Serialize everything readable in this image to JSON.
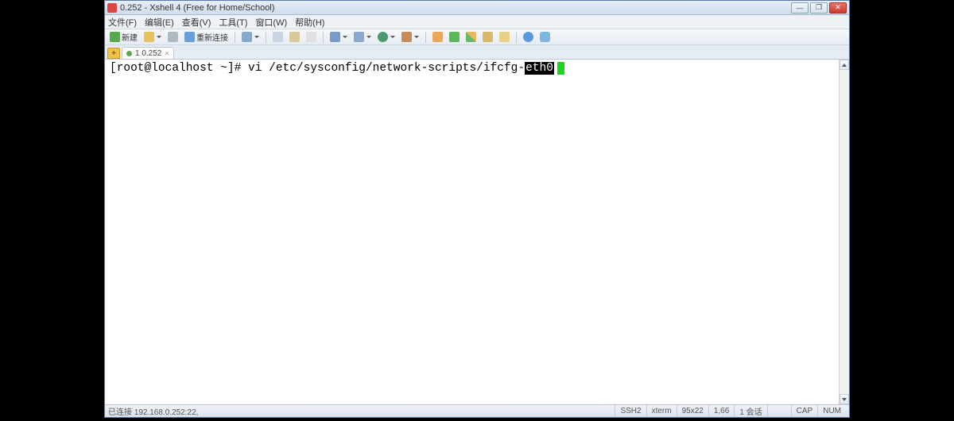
{
  "titlebar": {
    "text": "0.252 - Xshell 4 (Free for Home/School)"
  },
  "menu": {
    "file": "文件(F)",
    "edit": "编辑(E)",
    "view": "查看(V)",
    "tools": "工具(T)",
    "window": "窗口(W)",
    "help": "帮助(H)"
  },
  "toolbar": {
    "new": "新建",
    "reconnect": "重新连接"
  },
  "tab": {
    "label": "1 0.252"
  },
  "terminal": {
    "prompt": "[root@localhost ~]# ",
    "command": "vi /etc/sysconfig/network-scripts/ifcfg-",
    "highlighted": "eth0"
  },
  "status": {
    "connection": "已连接 192.168.0.252:22,",
    "protocol": "SSH2",
    "term": "xterm",
    "size": "95x22",
    "pos": "1,66",
    "session": "1 会话",
    "cap": "CAP",
    "num": "NUM"
  },
  "colors": {
    "cursor": "#1dd41d"
  }
}
